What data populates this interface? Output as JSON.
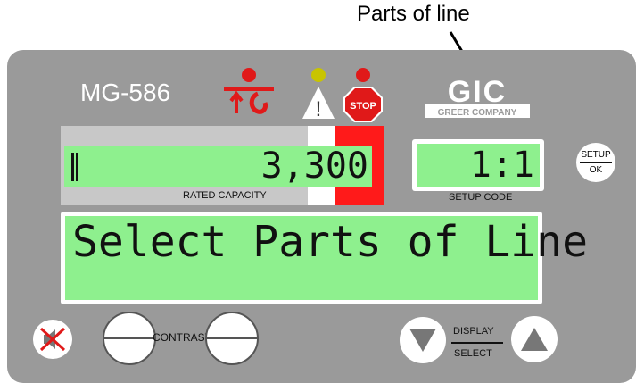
{
  "callout": {
    "label": "Parts of line"
  },
  "device": {
    "model": "MG-586",
    "rated_capacity": {
      "value": "3,300",
      "label": "RATED CAPACITY"
    },
    "setup_code": {
      "value": "1:1",
      "label": "SETUP CODE"
    },
    "message": "Select Parts of Line",
    "logo_text": {
      "top": "GIC",
      "bottom": "GREER COMPANY"
    },
    "stop_label": "STOP",
    "warning_label": "!"
  },
  "buttons": {
    "setup_ok": {
      "top": "SETUP",
      "bottom": "OK"
    },
    "contrast_label": "CONTRAST",
    "display_label": "DISPLAY",
    "select_label": "SELECT"
  },
  "colors": {
    "panel": "#9a9a9a",
    "lcd": "#8ef08e",
    "alarm_red": "#ff1a1a",
    "warning_yellow": "#c8c400"
  },
  "icons": {
    "boom": "crane-boom-icon",
    "warning": "warning-triangle-icon",
    "stop": "stop-sign-icon",
    "mute": "mute-speaker-icon",
    "down": "arrow-down-icon",
    "up": "arrow-up-icon"
  }
}
